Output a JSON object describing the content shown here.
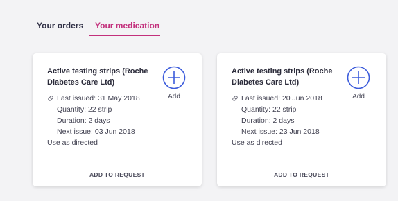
{
  "tabs": [
    {
      "label": "Your orders",
      "active": false
    },
    {
      "label": "Your medication",
      "active": true
    }
  ],
  "colors": {
    "accent": "#c3307c",
    "add_icon": "#3b5bdb",
    "background": "#f3f3f5"
  },
  "cards": [
    {
      "title": "Active testing strips (Roche Diabetes Care Ltd)",
      "add_label": "Add",
      "icon": "pill-icon",
      "last_issued": "Last issued: 31 May 2018",
      "quantity": "Quantity: 22 strip",
      "duration": "Duration: 2 days",
      "next_issue": "Next issue: 03 Jun 2018",
      "directions": "Use as directed",
      "action_label": "ADD TO REQUEST"
    },
    {
      "title": "Active testing strips (Roche Diabetes Care Ltd)",
      "add_label": "Add",
      "icon": "pill-icon",
      "last_issued": "Last issued: 20 Jun 2018",
      "quantity": "Quantity: 22 strip",
      "duration": "Duration: 2 days",
      "next_issue": "Next issue: 23 Jun 2018",
      "directions": "Use as directed",
      "action_label": "ADD TO REQUEST"
    }
  ]
}
